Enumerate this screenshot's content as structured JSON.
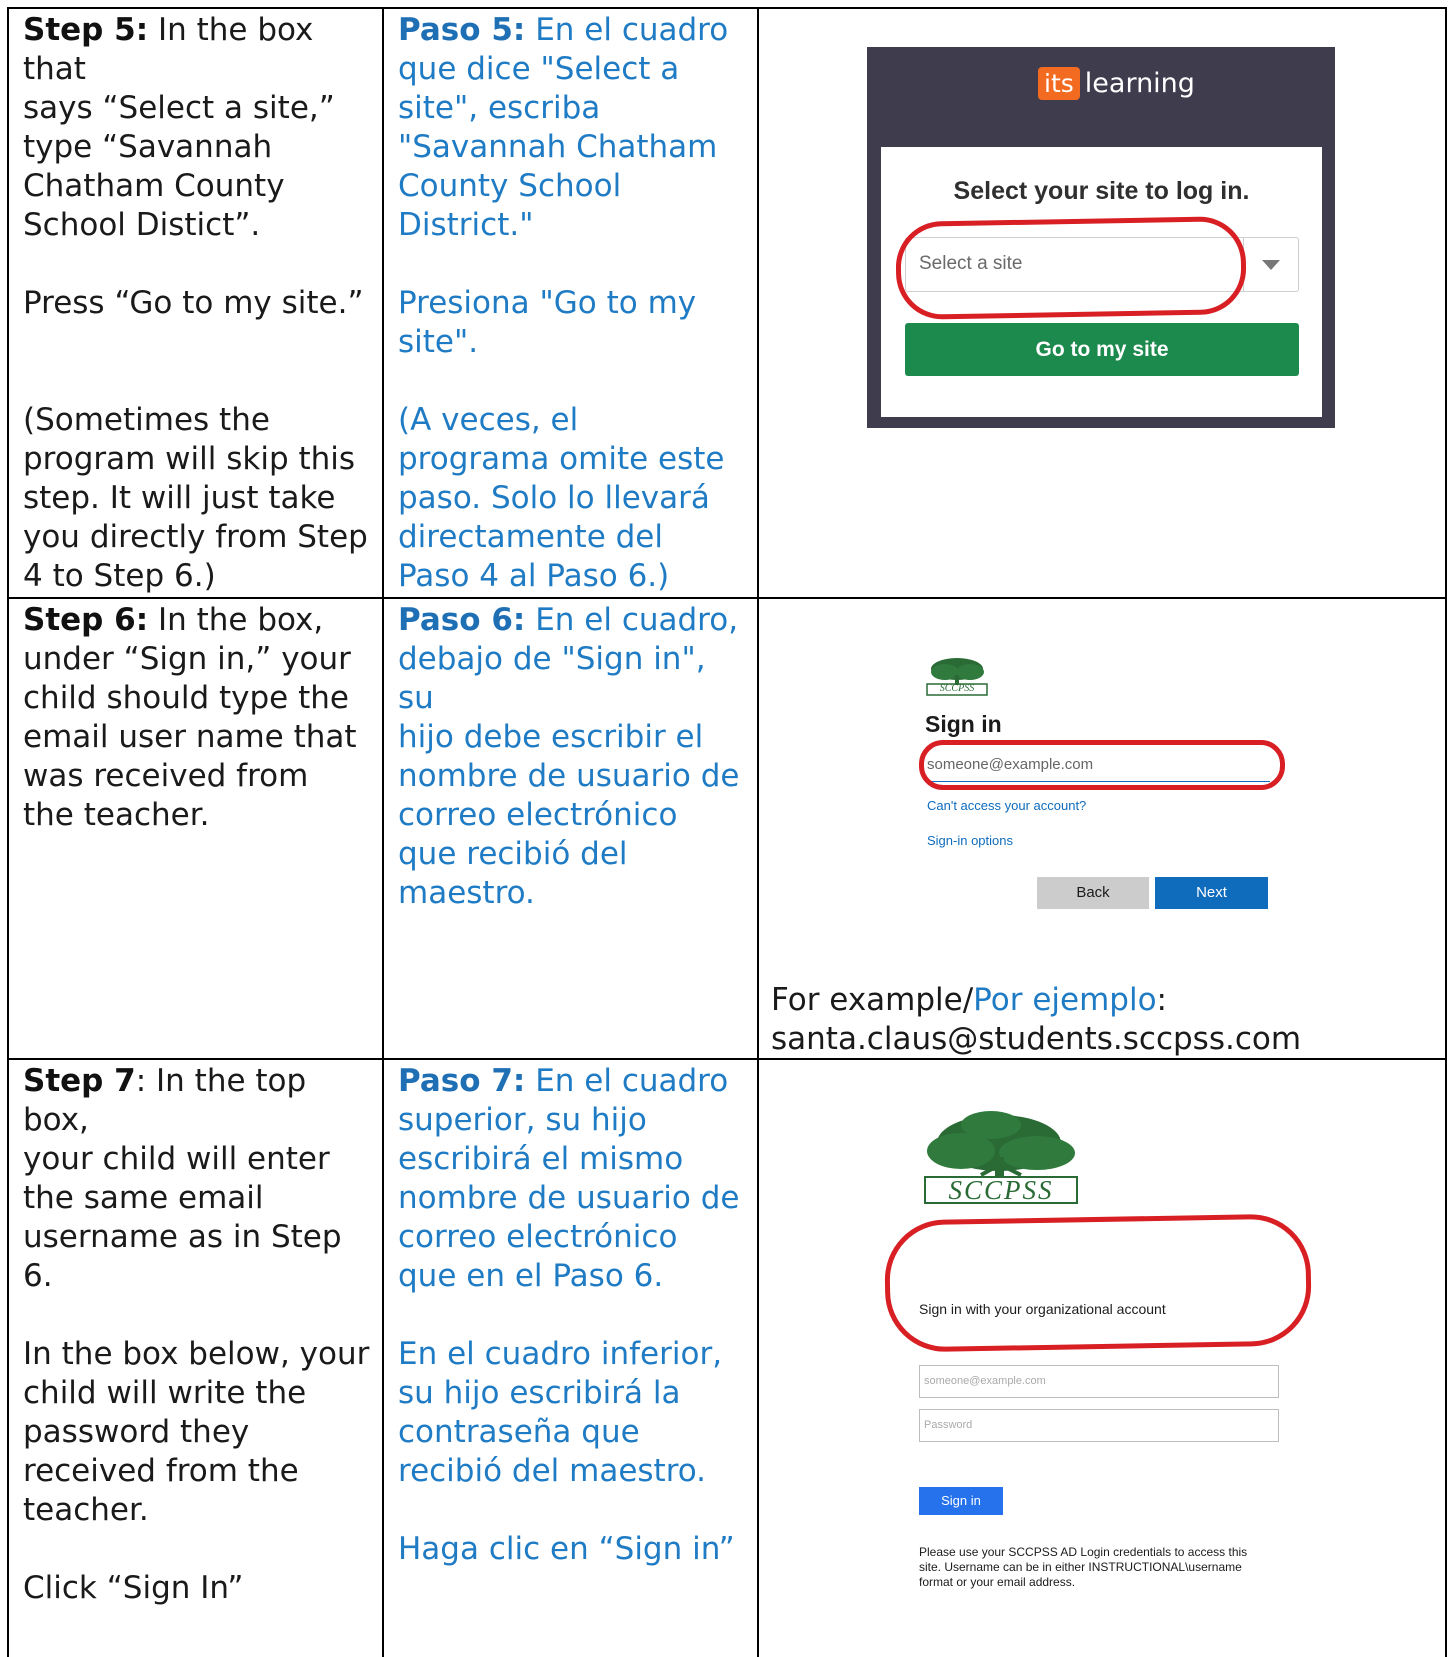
{
  "row1": {
    "en": {
      "step_label": "Step 5:",
      "lines1": [
        "In the box that",
        "says “Select a site,”",
        "type “Savannah",
        "Chatham County",
        "School Distict”."
      ],
      "line2": "Press “Go to my site.”",
      "lines3": [
        "(Sometimes the",
        "program will skip this",
        "step. It will just take",
        "you directly from Step",
        "4 to Step 6.)"
      ]
    },
    "es": {
      "step_label": "Paso 5:",
      "lines1": [
        "En el cuadro",
        "que dice \"Select a",
        "site\", escriba",
        "\"Savannah Chatham",
        "County School",
        "District.\""
      ],
      "lines2": [
        "Presiona \"Go to my",
        "site\"."
      ],
      "lines3": [
        "(A veces, el",
        "programa omite este",
        "paso. Solo lo llevará",
        "directamente del",
        "Paso 4 al Paso 6.)"
      ]
    },
    "shot": {
      "logo_its": "its",
      "logo_learning": "learning",
      "heading": "Select your site to log in.",
      "select_placeholder": "Select a site",
      "button": "Go to my site"
    }
  },
  "row2": {
    "en": {
      "step_label": "Step 6:",
      "lines": [
        "In the box,",
        "under “Sign in,” your",
        "child should type the",
        "email user name that",
        "was received from",
        "the teacher."
      ]
    },
    "es": {
      "step_label": "Paso 6:",
      "lines": [
        "En el cuadro,",
        "debajo de \"Sign in\", su",
        "hijo debe escribir el",
        "nombre de usuario de",
        "correo electrónico",
        "que recibió del",
        "maestro."
      ]
    },
    "shot": {
      "logo_text": "SCCPSS",
      "heading": "Sign in",
      "input_placeholder": "someone@example.com",
      "link1": "Can't access your account?",
      "link2": "Sign-in options",
      "back": "Back",
      "next": "Next"
    },
    "example": {
      "en": "For example/",
      "es": "Por ejemplo",
      "colon": ":",
      "email": "santa.claus@students.sccpss.com"
    }
  },
  "row3": {
    "en": {
      "step_label": "Step 7",
      "lines1": [
        ": In the top box,",
        "your child will enter",
        "the same email",
        "username as in Step 6."
      ],
      "lines2": [
        "In the box below, your",
        "child will write the",
        "password they",
        "received from the",
        "teacher."
      ],
      "line3": "Click “Sign In”"
    },
    "es": {
      "step_label": "Paso 7:",
      "lines1": [
        "En el cuadro",
        "superior, su hijo",
        "escribirá el mismo",
        "nombre de usuario de",
        "correo electrónico",
        "que en el Paso 6."
      ],
      "lines2": [
        "En el cuadro inferior,",
        "su hijo escribirá la",
        "contraseña que",
        "recibió del maestro."
      ],
      "line3": "Haga clic en “Sign in”"
    },
    "shot": {
      "logo_text": "SCCPSS",
      "heading": "Sign in with your organizational account",
      "email_placeholder": "someone@example.com",
      "password_placeholder": "Password",
      "button": "Sign in",
      "note": "Please use your SCCPSS AD Login credentials to access this site. Username can be in either INSTRUCTIONAL\\username format or your email address."
    }
  },
  "colors": {
    "english_text": "#1a1a1a",
    "spanish_text": "#1f7bc4",
    "annotation_red": "#d81f24",
    "its_orange": "#f36b21",
    "itslearning_bg": "#3e3c4d",
    "go_green": "#1c8a4c",
    "ms_blue": "#0f6cbd",
    "adfs_blue": "#2672ec",
    "tree_green": "#2a6b35"
  }
}
